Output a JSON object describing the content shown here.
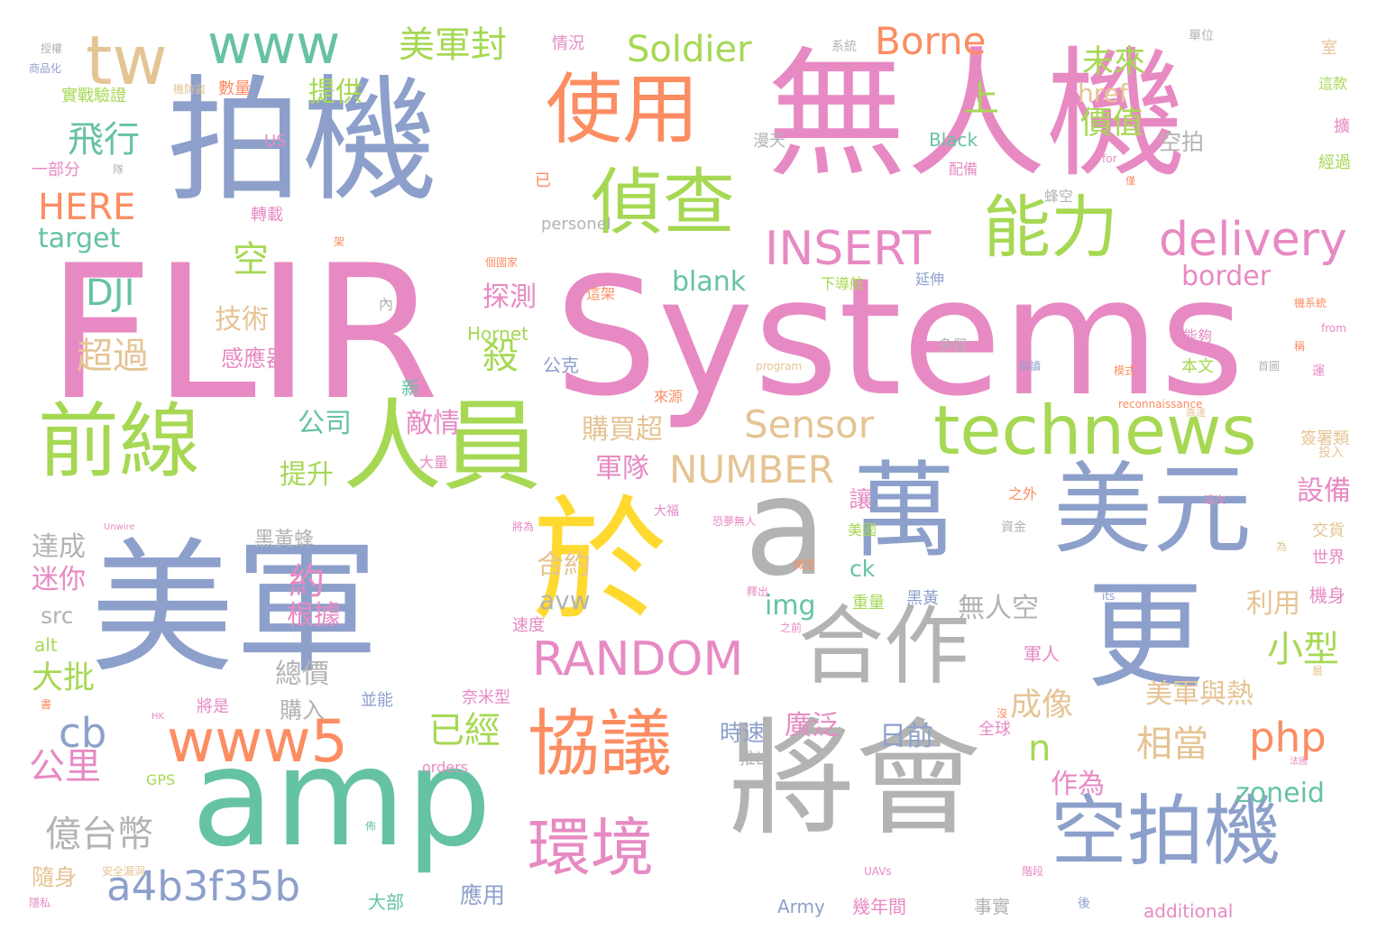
{
  "palette": {
    "pink": "#e78ac3",
    "blue": "#8da0cb",
    "green": "#a6d854",
    "teal": "#66c2a5",
    "orange": "#fc8d62",
    "yellow": "#ffd92f",
    "tan": "#e5c494",
    "gray": "#b3b3b3"
  },
  "words": [
    "FLIR",
    "Systems",
    "無人機",
    "拍機",
    "美軍",
    "於",
    "a",
    "amp",
    "將會",
    "萬",
    "美元",
    "更",
    "前線",
    "人員",
    "合作",
    "technews",
    "協議",
    "環境",
    "空拍機",
    "使用",
    "偵查",
    "能力",
    "www",
    "tw",
    "www5",
    "delivery",
    "INSERT",
    "RANDOM",
    "Sensor",
    "NUMBER",
    "a4b3f35b",
    "Borne",
    "Soldier",
    "美軍封",
    "cb",
    "php",
    "DJI",
    "HERE",
    "空",
    "n",
    "超過",
    "技術",
    "已經",
    "相當",
    "小型",
    "公里",
    "億台幣",
    "target",
    "飛行",
    "提供",
    "殺",
    "探測",
    "約",
    "上",
    "未來",
    "價值",
    "href",
    "border",
    "blank",
    "img",
    "avw",
    "無人空",
    "合約",
    "根據",
    "購買超",
    "軍隊",
    "設備",
    "成像",
    "zoneid",
    "作為",
    "利用",
    "美軍與熱",
    "廣泛",
    "日前",
    "時速",
    "敵情",
    "公司",
    "提升",
    "讓",
    "ck",
    "黑黃蜂",
    "達成",
    "迷你",
    "src",
    "alt",
    "大批",
    "總價",
    "購入",
    "隨身",
    "大部",
    "應用",
    "Army",
    "幾年間",
    "事實",
    "additional",
    "Black",
    "Hornet",
    "感應器",
    "公克",
    "新",
    "orders",
    "GPS",
    "奈米型",
    "並能",
    "速度",
    "重量",
    "黑黃",
    "美國",
    "交貨",
    "世界",
    "機身",
    "軍人",
    "全球",
    "US",
    "一部分",
    "實戰驗證",
    "數量",
    "情況",
    "系統",
    "單位",
    "授權",
    "商品化",
    "室",
    "這款",
    "擴",
    "經過",
    "配備",
    "空拍",
    "已",
    "for",
    "僅",
    "蜂空",
    "personel",
    "個國家",
    "延伸",
    "機系統",
    "下導航",
    "這架",
    "內",
    "多個",
    "from",
    "program",
    "前讀",
    "模式",
    "首圖",
    "reconnaissance",
    "高達",
    "大量",
    "之外",
    "能夠",
    "簽署類",
    "投入",
    "來源",
    "將為",
    "Unwire",
    "恐夢無人",
    "這次",
    "資金",
    "最",
    "將是",
    "HK",
    "沒",
    "推出",
    "安全漏洞",
    "隱私",
    "UAVs",
    "its",
    "階段",
    "後",
    "佈",
    "法國",
    "本文",
    "稱",
    "運",
    "為",
    "大福",
    "微型",
    "釋出",
    "之前",
    "書",
    "機防盜",
    "隊",
    "轉載",
    "架",
    "漫天"
  ]
}
